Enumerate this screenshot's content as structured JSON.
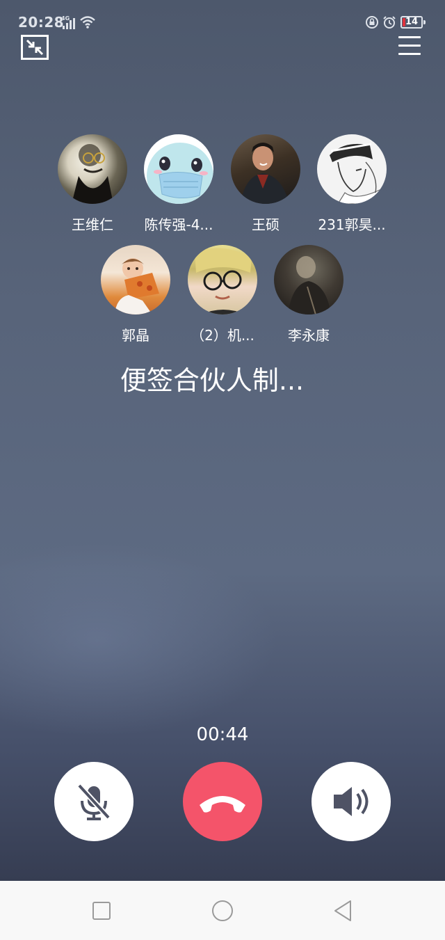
{
  "status_bar": {
    "time": "20:28",
    "network": "4G",
    "battery_level": "14",
    "icons": [
      "signal-icon",
      "wifi-icon",
      "rotation-lock-icon",
      "alarm-icon",
      "battery-icon"
    ]
  },
  "toolbar": {
    "minimize_icon": "minimize-window-icon",
    "menu_icon": "menu-icon"
  },
  "participants": [
    {
      "name": "王维仁"
    },
    {
      "name": "陈传强-4..."
    },
    {
      "name": "王硕"
    },
    {
      "name": "231郭昊..."
    },
    {
      "name": "郭晶"
    },
    {
      "name": "（2）机..."
    },
    {
      "name": "李永康"
    }
  ],
  "call": {
    "group_name": "便签合伙人制...",
    "duration": "00:44"
  },
  "controls": {
    "mute_icon": "microphone-muted-icon",
    "hangup_icon": "phone-hangup-icon",
    "speaker_icon": "speaker-icon"
  },
  "colors": {
    "hangup": "#f4546a",
    "background_top": "#4d586c",
    "background_bottom": "#363d52",
    "icon_dark": "#4f5365"
  },
  "nav": {
    "icons": [
      "recents-square-icon",
      "home-circle-icon",
      "back-triangle-icon"
    ]
  }
}
